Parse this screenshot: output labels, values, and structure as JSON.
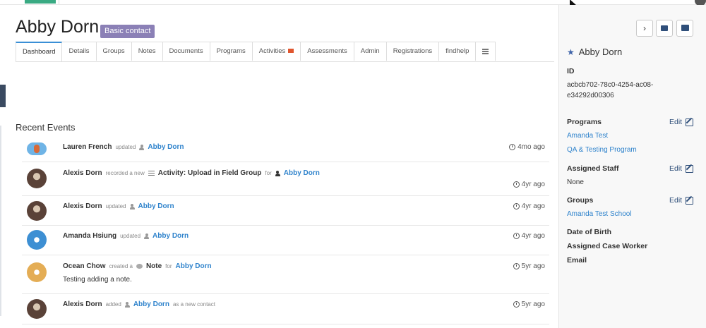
{
  "page": {
    "contact_name": "Abby Dorn",
    "badge": "Basic contact",
    "tabs": [
      "Dashboard",
      "Details",
      "Groups",
      "Notes",
      "Documents",
      "Programs",
      "Activities",
      "Assessments",
      "Admin",
      "Registrations",
      "findhelp"
    ],
    "active_tab": "Dashboard",
    "recent_events_title": "Recent Events"
  },
  "events": [
    {
      "actor": "Lauren French",
      "action": "updated",
      "target": "Abby Dorn",
      "time": "4mo ago",
      "avatar": "lauren-avatar"
    },
    {
      "actor": "Alexis Dorn",
      "action": "recorded a new",
      "item": "Activity: Upload in Field Group",
      "for": "for",
      "target": "Abby Dorn",
      "time": "4yr ago",
      "avatar": "alexis-avatar"
    },
    {
      "actor": "Alexis Dorn",
      "action": "updated",
      "target": "Abby Dorn",
      "time": "4yr ago",
      "avatar": "alexis-avatar"
    },
    {
      "actor": "Amanda Hsiung",
      "action": "updated",
      "target": "Abby Dorn",
      "time": "4yr ago",
      "avatar": "amanda-avatar"
    },
    {
      "actor": "Ocean Chow",
      "action": "created a",
      "item": "Note",
      "for": "for",
      "target": "Abby Dorn",
      "note": "Testing adding a note.",
      "time": "5yr ago",
      "avatar": "ocean-avatar"
    },
    {
      "actor": "Alexis Dorn",
      "action": "added",
      "target": "Abby Dorn",
      "suffix": "as a new contact",
      "time": "5yr ago",
      "avatar": "alexis-avatar"
    }
  ],
  "sidebar": {
    "name": "Abby Dorn",
    "id_label": "ID",
    "id_value_1": "acbcb702-78c0-4254-ac08-",
    "id_value_2": "e34292d00306",
    "programs_label": "Programs",
    "programs": [
      "Amanda Test",
      "QA & Testing Program"
    ],
    "staff_label": "Assigned Staff",
    "staff_value": "None",
    "groups_label": "Groups",
    "groups": [
      "Amanda Test School"
    ],
    "dob_label": "Date of Birth",
    "case_worker_label": "Assigned Case Worker",
    "email_label": "Email",
    "edit_label": "Edit"
  }
}
